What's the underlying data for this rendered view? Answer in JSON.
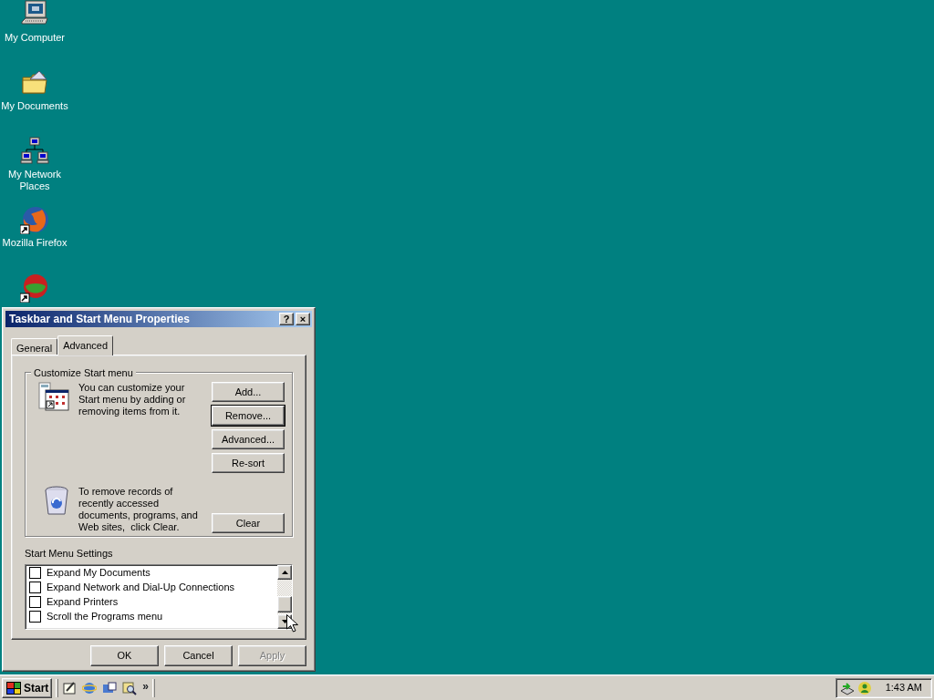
{
  "desktop_icons": [
    {
      "kind": "computer",
      "label": "My Computer",
      "shortcut": false
    },
    {
      "kind": "folder",
      "label": "My Documents",
      "shortcut": false
    },
    {
      "kind": "network",
      "label": "My Network Places",
      "shortcut": false
    },
    {
      "kind": "firefox",
      "label": "Mozilla Firefox",
      "shortcut": true
    },
    {
      "kind": "app",
      "shortcut": true
    }
  ],
  "dialog": {
    "title": "Taskbar and Start Menu Properties",
    "title_buttons": [
      "?",
      "×"
    ],
    "tabs": [
      {
        "label": "General",
        "selected": false
      },
      {
        "label": "Advanced",
        "selected": true
      }
    ],
    "customize": {
      "title": "Customize Start menu",
      "text": "You can customize your Start menu by adding or removing items from it.",
      "buttons": [
        {
          "label": "Add...",
          "default": false
        },
        {
          "label": "Remove...",
          "default": true
        },
        {
          "label": "Advanced...",
          "default": false
        },
        {
          "label": "Re-sort",
          "default": false
        }
      ],
      "clear_text": "To remove records of recently accessed documents, programs, and Web sites,  click Clear.",
      "clear_button": "Clear"
    },
    "settings": {
      "label": "Start Menu Settings",
      "items": [
        {
          "label": "Expand My Documents",
          "checked": false
        },
        {
          "label": "Expand Network and Dial-Up Connections",
          "checked": false
        },
        {
          "label": "Expand Printers",
          "checked": false
        },
        {
          "label": "Scroll the Programs menu",
          "checked": false
        }
      ]
    },
    "footer_buttons": [
      {
        "label": "OK",
        "disabled": false
      },
      {
        "label": "Cancel",
        "disabled": false
      },
      {
        "label": "Apply",
        "disabled": true
      }
    ]
  },
  "taskbar": {
    "start": "Start",
    "quick_launch": [
      {
        "kind": "desktop"
      },
      {
        "kind": "browser"
      },
      {
        "kind": "mail"
      },
      {
        "kind": "search"
      }
    ],
    "chevron": "»",
    "tray_icons": [
      {
        "kind": "network"
      },
      {
        "kind": "messenger"
      }
    ],
    "clock": "1:43 AM"
  }
}
